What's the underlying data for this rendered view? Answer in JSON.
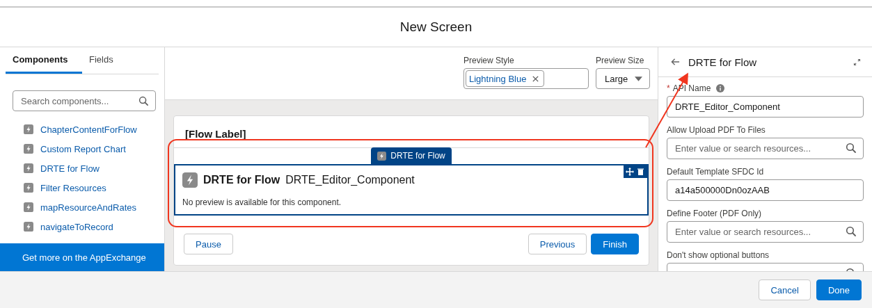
{
  "window": {
    "title": "New Screen"
  },
  "left_panel": {
    "tabs": [
      {
        "label": "Components",
        "selected": true
      },
      {
        "label": "Fields",
        "selected": false
      }
    ],
    "search": {
      "placeholder": "Search components..."
    },
    "items": [
      {
        "label": "ChapterContentForFlow"
      },
      {
        "label": "Custom Report Chart"
      },
      {
        "label": "DRTE for Flow"
      },
      {
        "label": "Filter Resources"
      },
      {
        "label": "mapResourceAndRates"
      },
      {
        "label": "navigateToRecord"
      }
    ],
    "appexchange_button": "Get more on the AppExchange"
  },
  "preview": {
    "style_label": "Preview Style",
    "style_pill": "Lightning Blue",
    "size_label": "Preview Size",
    "size_value": "Large"
  },
  "canvas": {
    "flow_label": "[Flow Label]",
    "component_tab": "DRTE for Flow",
    "component_title": "DRTE for Flow",
    "component_api": "DRTE_Editor_Component",
    "component_note": "No preview is available for this component.",
    "buttons": [
      {
        "label": "Pause",
        "kind": "neutral"
      },
      {
        "label": "Previous",
        "kind": "neutral"
      },
      {
        "label": "Finish",
        "kind": "brand"
      }
    ]
  },
  "properties": {
    "title": "DRTE for Flow",
    "fields": [
      {
        "label": "API Name",
        "required_mark": "*",
        "info": true,
        "value": "DRTE_Editor_Component",
        "kind": "text"
      },
      {
        "label": "Allow Upload PDF To Files",
        "info": false,
        "placeholder": "Enter value or search resources...",
        "kind": "lookup"
      },
      {
        "label": "Default Template SFDC Id",
        "info": false,
        "value": "a14a500000Dn0ozAAB",
        "kind": "text"
      },
      {
        "label": "Define Footer (PDF Only)",
        "info": false,
        "placeholder": "Enter value or search resources...",
        "kind": "lookup"
      },
      {
        "label": "Don't show optional buttons",
        "info": false,
        "kind": "lookup"
      }
    ]
  },
  "footer": {
    "buttons": [
      {
        "label": "Cancel",
        "kind": "neutral"
      },
      {
        "label": "Done",
        "kind": "brand"
      }
    ]
  }
}
